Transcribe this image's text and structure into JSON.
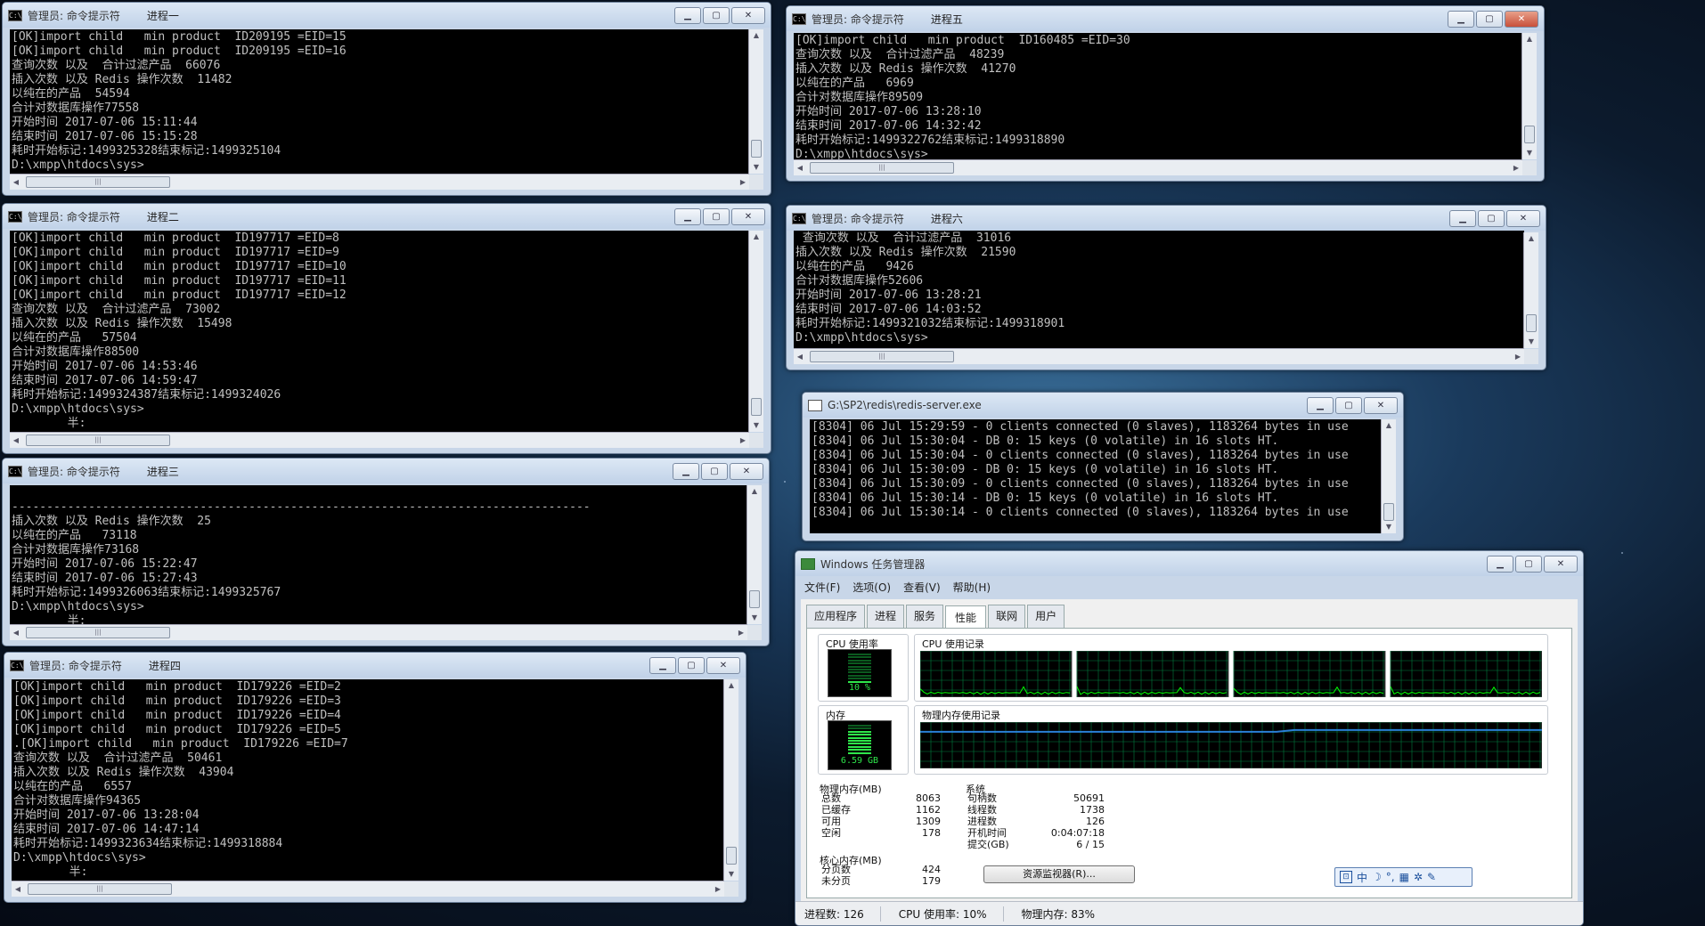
{
  "consoles": [
    {
      "id": "c1",
      "title": "管理员: 命令提示符",
      "proc": "进程一",
      "lines": [
        "[OK]import child   min product  ID209195 =EID=15",
        "[OK]import child   min product  ID209195 =EID=16",
        "查询次数 以及  合计过滤产品  66076",
        "插入次数 以及 Redis 操作次数  11482",
        "以纯在的产品  54594",
        "合计对数据库操作77558",
        "开始时间 2017-07-06 15:11:44",
        "结束时间 2017-07-06 15:15:28",
        "耗时开始标记:1499325328结束标记:1499325104",
        "D:\\xmpp\\htdocs\\sys>"
      ]
    },
    {
      "id": "c2",
      "title": "管理员: 命令提示符",
      "proc": "进程二",
      "lines": [
        "[OK]import child   min product  ID197717 =EID=8",
        "[OK]import child   min product  ID197717 =EID=9",
        "[OK]import child   min product  ID197717 =EID=10",
        "[OK]import child   min product  ID197717 =EID=11",
        "[OK]import child   min product  ID197717 =EID=12",
        "查询次数 以及  合计过滤产品  73002",
        "插入次数 以及 Redis 操作次数  15498",
        "以纯在的产品   57504",
        "合计对数据库操作88500",
        "开始时间 2017-07-06 14:53:46",
        "结束时间 2017-07-06 14:59:47",
        "耗时开始标记:1499324387结束标记:1499324026",
        "D:\\xmpp\\htdocs\\sys>",
        "        半:"
      ]
    },
    {
      "id": "c3",
      "title": "管理员: 命令提示符",
      "proc": "进程三",
      "lines": [
        "",
        "-----------------------------------------------------------------------------------",
        "插入次数 以及 Redis 操作次数  25",
        "以纯在的产品   73118",
        "合计对数据库操作73168",
        "开始时间 2017-07-06 15:22:47",
        "结束时间 2017-07-06 15:27:43",
        "耗时开始标记:1499326063结束标记:1499325767",
        "D:\\xmpp\\htdocs\\sys>",
        "        半:"
      ]
    },
    {
      "id": "c4",
      "title": "管理员: 命令提示符",
      "proc": "进程四",
      "lines": [
        "[OK]import child   min product  ID179226 =EID=2",
        "[OK]import child   min product  ID179226 =EID=3",
        "[OK]import child   min product  ID179226 =EID=4",
        "[OK]import child   min product  ID179226 =EID=5",
        ".[OK]import child   min product  ID179226 =EID=7",
        "查询次数 以及  合计过滤产品  50461",
        "插入次数 以及 Redis 操作次数  43904",
        "以纯在的产品   6557",
        "合计对数据库操作94365",
        "开始时间 2017-07-06 13:28:04",
        "结束时间 2017-07-06 14:47:14",
        "耗时开始标记:1499323634结束标记:1499318884",
        "D:\\xmpp\\htdocs\\sys>",
        "        半:"
      ]
    },
    {
      "id": "c5",
      "title": "管理员: 命令提示符",
      "proc": "进程五",
      "lines": [
        "[OK]import child   min product  ID160485 =EID=30",
        "查询次数 以及  合计过滤产品  48239",
        "插入次数 以及 Redis 操作次数  41270",
        "以纯在的产品   6969",
        "合计对数据库操作89509",
        "开始时间 2017-07-06 13:28:10",
        "结束时间 2017-07-06 14:32:42",
        "耗时开始标记:1499322762结束标记:1499318890",
        "D:\\xmpp\\htdocs\\sys>"
      ]
    },
    {
      "id": "c6",
      "title": "管理员: 命令提示符",
      "proc": "进程六",
      "lines": [
        " 查询次数 以及  合计过滤产品  31016",
        "插入次数 以及 Redis 操作次数  21590",
        "以纯在的产品   9426",
        "合计对数据库操作52606",
        "开始时间 2017-07-06 13:28:21",
        "结束时间 2017-07-06 14:03:52",
        "耗时开始标记:1499321032结束标记:1499318901",
        "D:\\xmpp\\htdocs\\sys>"
      ]
    },
    {
      "id": "c7",
      "title": "G:\\SP2\\redis\\redis-server.exe",
      "proc": "",
      "lines": [
        "[8304] 06 Jul 15:29:59 - 0 clients connected (0 slaves), 1183264 bytes in use",
        "[8304] 06 Jul 15:30:04 - DB 0: 15 keys (0 volatile) in 16 slots HT.",
        "[8304] 06 Jul 15:30:04 - 0 clients connected (0 slaves), 1183264 bytes in use",
        "[8304] 06 Jul 15:30:09 - DB 0: 15 keys (0 volatile) in 16 slots HT.",
        "[8304] 06 Jul 15:30:09 - 0 clients connected (0 slaves), 1183264 bytes in use",
        "[8304] 06 Jul 15:30:14 - DB 0: 15 keys (0 volatile) in 16 slots HT.",
        "[8304] 06 Jul 15:30:14 - 0 clients connected (0 slaves), 1183264 bytes in use"
      ]
    }
  ],
  "taskmgr": {
    "title": "Windows 任务管理器",
    "menu": [
      "文件(F)",
      "选项(O)",
      "查看(V)",
      "帮助(H)"
    ],
    "tabs": [
      "应用程序",
      "进程",
      "服务",
      "性能",
      "联网",
      "用户"
    ],
    "active_tab": "性能",
    "cpu_usage_label": "CPU 使用率",
    "cpu_usage_value": "10 %",
    "cpu_usage_fraction": 0.1,
    "cpu_history_label": "CPU 使用记录",
    "mem_label": "内存",
    "mem_value": "6.59 GB",
    "mem_fraction": 0.83,
    "mem_history_label": "物理内存使用记录",
    "physical_title": "物理内存(MB)",
    "physical": [
      [
        "总数",
        "8063"
      ],
      [
        "已缓存",
        "1162"
      ],
      [
        "可用",
        "1309"
      ],
      [
        "空闲",
        "178"
      ]
    ],
    "kernel_title": "核心内存(MB)",
    "kernel": [
      [
        "分页数",
        "424"
      ],
      [
        "未分页",
        "179"
      ]
    ],
    "system_title": "系统",
    "system": [
      [
        "句柄数",
        "50691"
      ],
      [
        "线程数",
        "1738"
      ],
      [
        "进程数",
        "126"
      ],
      [
        "开机时间",
        "0:04:07:18"
      ],
      [
        "提交(GB)",
        "6 / 15"
      ]
    ],
    "resource_button": "资源监视器(R)...",
    "status": [
      "进程数: 126",
      "CPU 使用率: 10%",
      "物理内存: 83%"
    ],
    "colors": {
      "graph_grid": "#008040",
      "graph_line": "#00ff00",
      "mem_line": "#2a7fd6"
    }
  },
  "ime_bar": {
    "label": "中",
    "icons": [
      "ime-mode-icon",
      "moon-icon",
      "punctuation-icon",
      "keyboard-icon",
      "settings-icon",
      "wrench-icon"
    ]
  }
}
